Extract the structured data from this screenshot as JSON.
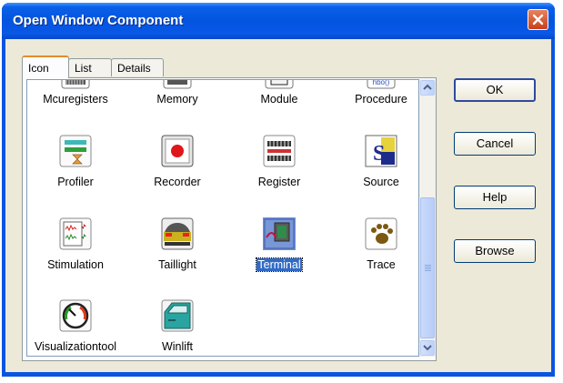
{
  "window": {
    "title": "Open Window Component"
  },
  "tabs": [
    {
      "label": "Icon",
      "active": true
    },
    {
      "label": "List",
      "active": false
    },
    {
      "label": "Details",
      "active": false
    }
  ],
  "items": [
    {
      "label": "Mcuregisters",
      "icon": "mcuregisters-icon"
    },
    {
      "label": "Memory",
      "icon": "memory-icon"
    },
    {
      "label": "Module",
      "icon": "module-icon"
    },
    {
      "label": "Procedure",
      "icon": "procedure-icon"
    },
    {
      "label": "Profiler",
      "icon": "profiler-icon"
    },
    {
      "label": "Recorder",
      "icon": "recorder-icon"
    },
    {
      "label": "Register",
      "icon": "register-icon"
    },
    {
      "label": "Source",
      "icon": "source-icon"
    },
    {
      "label": "Stimulation",
      "icon": "stimulation-icon"
    },
    {
      "label": "Taillight",
      "icon": "taillight-icon"
    },
    {
      "label": "Terminal",
      "icon": "terminal-icon",
      "selected": true
    },
    {
      "label": "Trace",
      "icon": "trace-icon"
    },
    {
      "label": "Visualizationtool",
      "icon": "visualizationtool-icon"
    },
    {
      "label": "Winlift",
      "icon": "winlift-icon"
    }
  ],
  "buttons": {
    "ok": "OK",
    "cancel": "Cancel",
    "help": "Help",
    "browse": "Browse"
  },
  "colors": {
    "titlebar": "#0a55e0",
    "selection": "#316ac5",
    "face": "#ece9d8"
  }
}
